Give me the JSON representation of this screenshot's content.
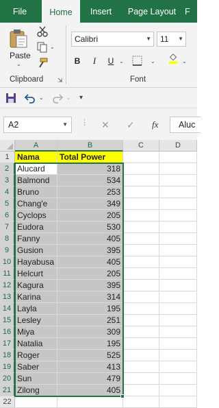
{
  "ribbon_tabs": [
    {
      "label": "File"
    },
    {
      "label": "Home"
    },
    {
      "label": "Insert"
    },
    {
      "label": "Page Layout"
    },
    {
      "label": "F"
    }
  ],
  "clipboard": {
    "paste_label": "Paste",
    "group_label": "Clipboard"
  },
  "font": {
    "name": "Calibri",
    "size": "11",
    "group_label": "Font",
    "bold": "B",
    "italic": "I",
    "underline": "U"
  },
  "formula_bar": {
    "name_box": "A2",
    "fx": "fx",
    "value": "Aluc"
  },
  "grid": {
    "columns": [
      "A",
      "B",
      "C",
      "D"
    ],
    "selected_columns": [
      "A",
      "B"
    ],
    "rows": [
      {
        "num": "1",
        "a": "Nama",
        "b": "Total Power"
      },
      {
        "num": "2",
        "a": "Alucard",
        "b": "318"
      },
      {
        "num": "3",
        "a": "Balmond",
        "b": "534"
      },
      {
        "num": "4",
        "a": "Bruno",
        "b": "253"
      },
      {
        "num": "5",
        "a": "Chang'e",
        "b": "349"
      },
      {
        "num": "6",
        "a": "Cyclops",
        "b": "205"
      },
      {
        "num": "7",
        "a": "Eudora",
        "b": "530"
      },
      {
        "num": "8",
        "a": "Fanny",
        "b": "405"
      },
      {
        "num": "9",
        "a": "Gusion",
        "b": "395"
      },
      {
        "num": "10",
        "a": "Hayabusa",
        "b": "405"
      },
      {
        "num": "11",
        "a": "Helcurt",
        "b": "205"
      },
      {
        "num": "12",
        "a": "Kagura",
        "b": "395"
      },
      {
        "num": "13",
        "a": "Karina",
        "b": "314"
      },
      {
        "num": "14",
        "a": "Layla",
        "b": "195"
      },
      {
        "num": "15",
        "a": "Lesley",
        "b": "251"
      },
      {
        "num": "16",
        "a": "Miya",
        "b": "309"
      },
      {
        "num": "17",
        "a": "Natalia",
        "b": "195"
      },
      {
        "num": "18",
        "a": "Roger",
        "b": "525"
      },
      {
        "num": "19",
        "a": "Saber",
        "b": "413"
      },
      {
        "num": "20",
        "a": "Sun",
        "b": "479"
      },
      {
        "num": "21",
        "a": "Zilong",
        "b": "405"
      },
      {
        "num": "22",
        "a": "",
        "b": ""
      }
    ]
  },
  "colors": {
    "accent": "#217346",
    "header_fill": "#ffff00",
    "selection": "#c6c6c6"
  }
}
